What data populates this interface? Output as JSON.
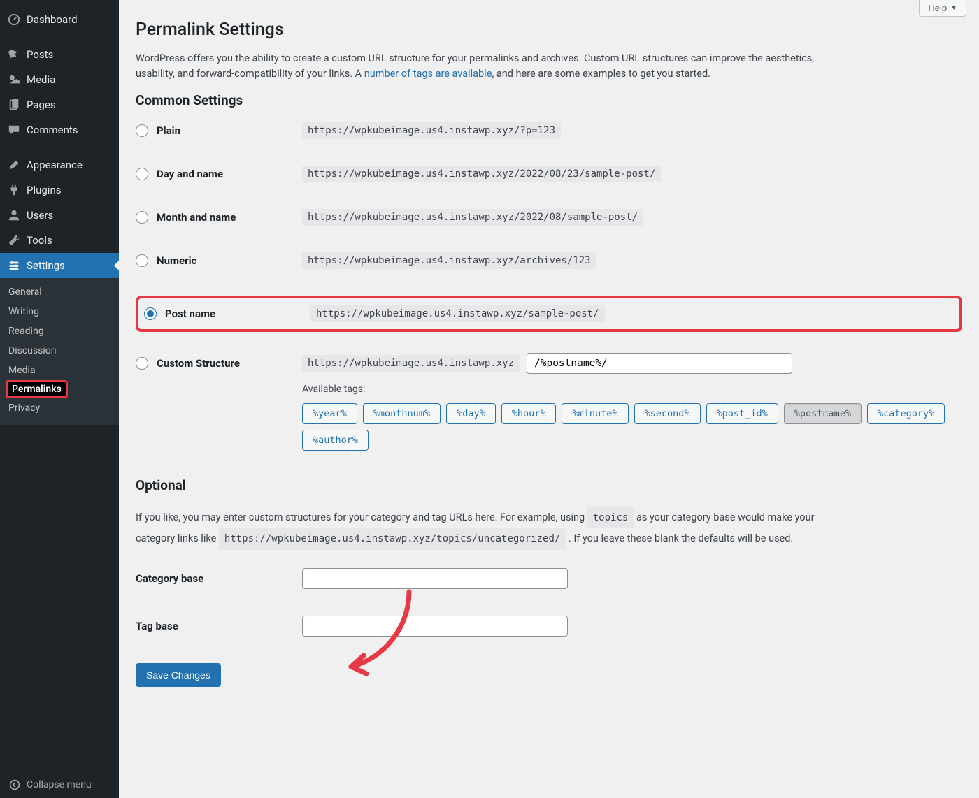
{
  "sidebar": {
    "items": [
      {
        "label": "Dashboard",
        "icon": "dashboard-icon"
      },
      {
        "label": "Posts",
        "icon": "pin-icon"
      },
      {
        "label": "Media",
        "icon": "media-icon"
      },
      {
        "label": "Pages",
        "icon": "pages-icon"
      },
      {
        "label": "Comments",
        "icon": "comments-icon"
      },
      {
        "label": "Appearance",
        "icon": "appearance-icon"
      },
      {
        "label": "Plugins",
        "icon": "plugins-icon"
      },
      {
        "label": "Users",
        "icon": "users-icon"
      },
      {
        "label": "Tools",
        "icon": "tools-icon"
      },
      {
        "label": "Settings",
        "icon": "settings-icon"
      }
    ],
    "submenu": [
      {
        "label": "General"
      },
      {
        "label": "Writing"
      },
      {
        "label": "Reading"
      },
      {
        "label": "Discussion"
      },
      {
        "label": "Media"
      },
      {
        "label": "Permalinks",
        "current": true
      },
      {
        "label": "Privacy"
      }
    ],
    "collapse_label": "Collapse menu"
  },
  "help_label": "Help",
  "page_title": "Permalink Settings",
  "intro_part1": "WordPress offers you the ability to create a custom URL structure for your permalinks and archives. Custom URL structures can improve the aesthetics, usability, and forward-compatibility of your links. A ",
  "intro_link": "number of tags are available",
  "intro_part2": ", and here are some examples to get you started.",
  "common_heading": "Common Settings",
  "options": {
    "plain": {
      "label": "Plain",
      "sample": "https://wpkubeimage.us4.instawp.xyz/?p=123"
    },
    "dayname": {
      "label": "Day and name",
      "sample": "https://wpkubeimage.us4.instawp.xyz/2022/08/23/sample-post/"
    },
    "month": {
      "label": "Month and name",
      "sample": "https://wpkubeimage.us4.instawp.xyz/2022/08/sample-post/"
    },
    "numeric": {
      "label": "Numeric",
      "sample": "https://wpkubeimage.us4.instawp.xyz/archives/123"
    },
    "postname": {
      "label": "Post name",
      "sample": "https://wpkubeimage.us4.instawp.xyz/sample-post/"
    },
    "custom": {
      "label": "Custom Structure",
      "base": "https://wpkubeimage.us4.instawp.xyz",
      "value": "/%postname%/"
    }
  },
  "available_tags_label": "Available tags:",
  "tags": [
    "%year%",
    "%monthnum%",
    "%day%",
    "%hour%",
    "%minute%",
    "%second%",
    "%post_id%",
    "%postname%",
    "%category%",
    "%author%"
  ],
  "selected_tag": "%postname%",
  "optional_heading": "Optional",
  "optional_text_1": "If you like, you may enter custom structures for your category and tag URLs here. For example, using ",
  "optional_code_1": "topics",
  "optional_text_2": " as your category base would make your category links like ",
  "optional_code_2": "https://wpkubeimage.us4.instawp.xyz/topics/uncategorized/",
  "optional_text_3": " . If you leave these blank the defaults will be used.",
  "category_base_label": "Category base",
  "tag_base_label": "Tag base",
  "category_base_value": "",
  "tag_base_value": "",
  "save_label": "Save Changes"
}
